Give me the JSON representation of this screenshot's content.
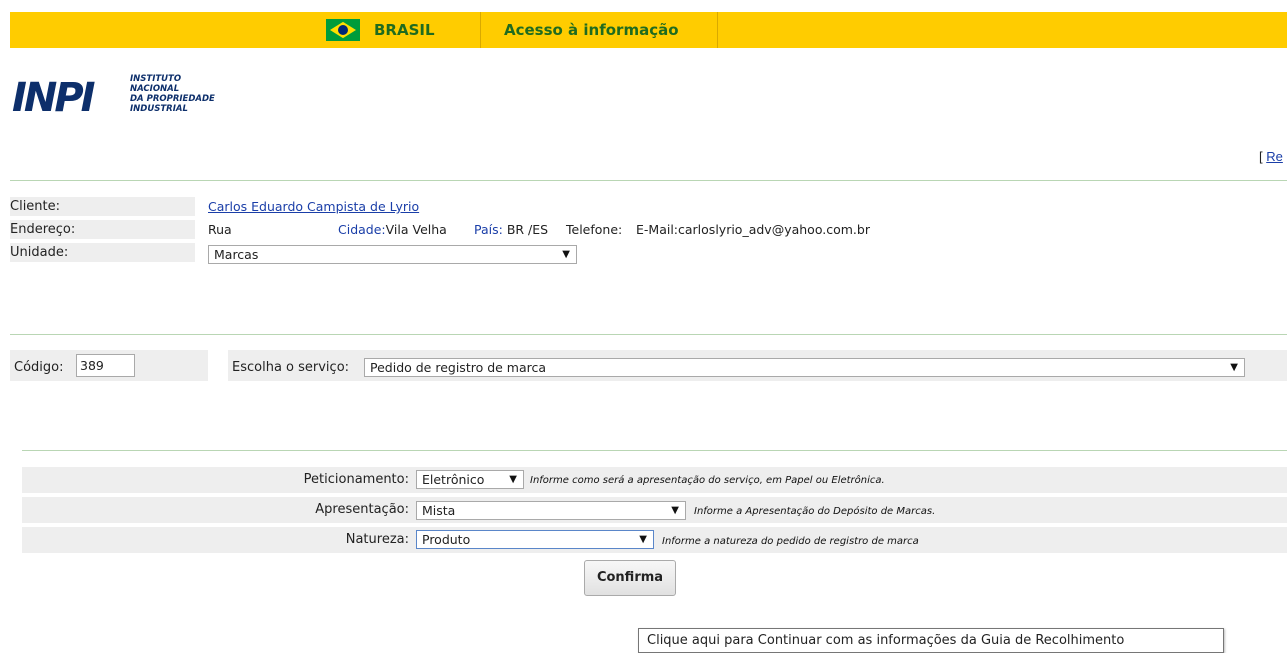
{
  "gov_bar": {
    "country_label": "BRASIL",
    "access_link": "Acesso à informação"
  },
  "logo": {
    "mark": "INPI",
    "lines": [
      "INSTITUTO",
      "NACIONAL",
      "DA PROPRIEDADE",
      "INDUSTRIAL"
    ]
  },
  "top_right": {
    "bracket": "[ ",
    "link": "Re"
  },
  "client": {
    "labels": {
      "cliente": "Cliente:",
      "endereco": "Endereço:",
      "unidade": "Unidade:"
    },
    "name": "Carlos Eduardo Campista de Lyrio",
    "address": {
      "street": "Rua",
      "cidade_label": "Cidade:",
      "cidade": "Vila Velha",
      "pais_label": "País:",
      "pais": "BR /ES",
      "telefone_label": "Telefone:",
      "email_label": "E-Mail:",
      "email": "carloslyrio_adv@yahoo.com.br"
    },
    "unidade_selected": "Marcas"
  },
  "service": {
    "codigo_label": "Código:",
    "codigo_value": "389",
    "escolha_label": "Escolha o serviço:",
    "servico_selected": "Pedido de registro de marca"
  },
  "form": {
    "peticionamento": {
      "label": "Peticionamento:",
      "selected": "Eletrônico",
      "hint": "Informe como será a apresentação do serviço, em Papel ou Eletrônica."
    },
    "apresentacao": {
      "label": "Apresentação:",
      "selected": "Mista",
      "hint": "Informe a Apresentação do Depósito de Marcas."
    },
    "natureza": {
      "label": "Natureza:",
      "selected": "Produto",
      "hint": "Informe a natureza do pedido de registro de marca"
    },
    "confirm_button": "Confirma"
  },
  "tooltip": "Clique aqui para Continuar com as informações da Guia de Recolhimento",
  "icons": {
    "dropdown": "chevron-down-icon",
    "flag": "brazil-flag-icon"
  },
  "colors": {
    "gov_bar": "#ffcc00",
    "gov_text": "#1f6b1f",
    "link": "#1a3ea8",
    "row_shade": "#eeeeee",
    "divider": "#b9d6b4",
    "logo": "#0d2f6b"
  }
}
